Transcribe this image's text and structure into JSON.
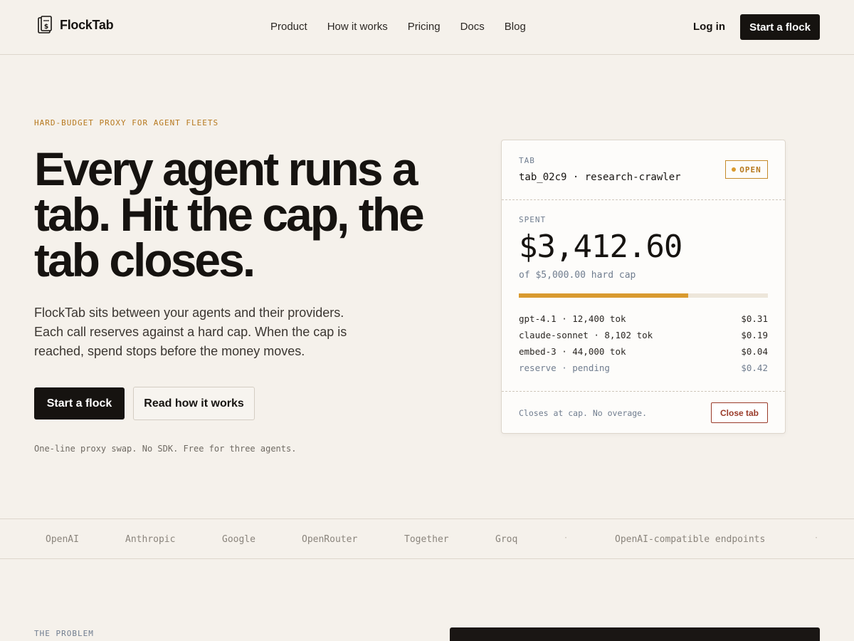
{
  "header": {
    "brand": "FlockTab",
    "nav": [
      "Product",
      "How it works",
      "Pricing",
      "Docs",
      "Blog"
    ],
    "login": "Log in",
    "cta": "Start a flock"
  },
  "hero": {
    "eyebrow": "HARD-BUDGET PROXY FOR AGENT FLEETS",
    "title": "Every agent runs a tab. Hit the cap, the tab closes.",
    "subtitle": "FlockTab sits between your agents and their providers. Each call reserves against a hard cap. When the cap is reached, spend stops before the money moves.",
    "primary_cta": "Start a flock",
    "secondary_cta": "Read how it works",
    "fineprint": "One-line proxy swap. No SDK. Free for three agents."
  },
  "tab_card": {
    "label": "TAB",
    "tab_id": "tab_02c9 · research-crawler",
    "status": "OPEN",
    "spent_label": "SPENT",
    "spent": "$3,412.60",
    "cap_text": "of $5,000.00 hard cap",
    "progress": 0.68,
    "ledger": [
      {
        "item": "gpt-4.1 · 12,400 tok",
        "amount": "$0.31"
      },
      {
        "item": "claude-sonnet · 8,102 tok",
        "amount": "$0.19"
      },
      {
        "item": "embed-3 · 44,000 tok",
        "amount": "$0.04"
      },
      {
        "item": "reserve · pending",
        "amount": "$0.42"
      }
    ],
    "footer_text": "Closes at cap. No overage.",
    "close_button": "Close tab"
  },
  "providers": [
    "OpenAI",
    "Anthropic",
    "Google",
    "OpenRouter",
    "Together",
    "Groq",
    "OpenAI-compatible endpoints"
  ],
  "problem": {
    "eyebrow": "THE PROBLEM"
  },
  "colors": {
    "background": "#f5f1eb",
    "ink": "#161310",
    "accent": "#d99a2f",
    "accent_text": "#b7791f",
    "danger": "#9a3b2a",
    "muted": "#707d8f"
  },
  "icons": {
    "logo": "ticket-stub-icon",
    "status": "dot-icon"
  }
}
